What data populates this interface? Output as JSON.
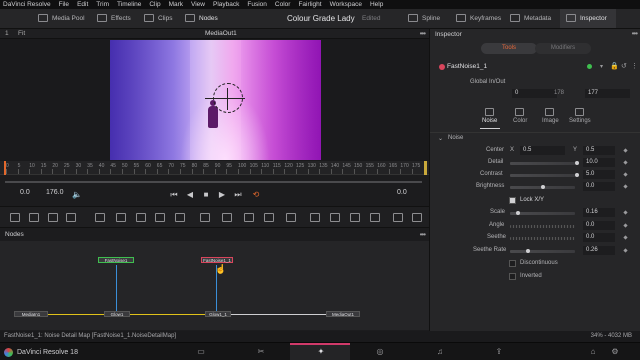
{
  "menubar": [
    "DaVinci Resolve",
    "File",
    "Edit",
    "Trim",
    "Timeline",
    "Clip",
    "Mark",
    "View",
    "Playback",
    "Fusion",
    "Color",
    "Fairlight",
    "Workspace",
    "Help"
  ],
  "toolbar": {
    "media_pool": "Media Pool",
    "effects": "Effects",
    "clips": "Clips",
    "nodes": "Nodes",
    "project_title": "Colour Grade Lady",
    "project_status": "Edited",
    "spline": "Spline",
    "keyframes": "Keyframes",
    "metadata": "Metadata",
    "inspector": "Inspector"
  },
  "viewer": {
    "index": "1",
    "fit": "Fit",
    "title": "MediaOut1",
    "ruler_ticks": [
      "0",
      "5",
      "10",
      "15",
      "20",
      "25",
      "30",
      "35",
      "40",
      "45",
      "50",
      "55",
      "60",
      "65",
      "70",
      "75",
      "80",
      "85",
      "90",
      "95",
      "100",
      "105",
      "110",
      "115",
      "120",
      "125",
      "130",
      "135",
      "140",
      "145",
      "150",
      "155",
      "160",
      "165",
      "170",
      "175"
    ],
    "tc_in": "0.0",
    "tc_out": "176.0",
    "tc_current": "0.0"
  },
  "nodes_panel": {
    "title": "Nodes",
    "nodes": {
      "fastnoise_a": "FastNoise1",
      "fastnoise_b": "FastNoise1_1",
      "media_in": "MediaIn1",
      "glow1": "Glow1",
      "glow1_1": "Glow1_1",
      "media_out": "MediaOut1"
    }
  },
  "status": {
    "left": "FastNoise1_1: Noise Detail Map   [FastNoise1_1.NoiseDetailMap]",
    "right": "34% - 4032 MB"
  },
  "pagebar": {
    "brand": "DaVinci Resolve 18"
  },
  "inspector": {
    "title": "Inspector",
    "seg_tools": "Tools",
    "seg_modifiers": "Modifiers",
    "node_name": "FastNoise1_1",
    "global_label": "Global In/Out",
    "global_in": "0",
    "global_mid": "178",
    "global_out": "177",
    "tabs": [
      "Noise",
      "Color",
      "Image",
      "Settings"
    ],
    "section": "Noise",
    "center_label": "Center",
    "center_x_label": "X",
    "center_x": "0.5",
    "center_y_label": "Y",
    "center_y": "0.5",
    "detail_label": "Detail",
    "detail": "10.0",
    "contrast_label": "Contrast",
    "contrast": "5.0",
    "brightness_label": "Brightness",
    "brightness": "0.0",
    "lock_label": "Lock X/Y",
    "scale_label": "Scale",
    "scale": "0.16",
    "angle_label": "Angle",
    "angle": "0.0",
    "seethe_label": "Seethe",
    "seethe": "0.0",
    "seethe_rate_label": "Seethe Rate",
    "seethe_rate": "0.26",
    "discontinuous_label": "Discontinuous",
    "inverted_label": "Inverted"
  },
  "colors": {
    "accent": "#e7683a",
    "node_yellow": "#e0c21a",
    "node_blue": "#3b8fd8",
    "active_page": "#d13a6a"
  }
}
